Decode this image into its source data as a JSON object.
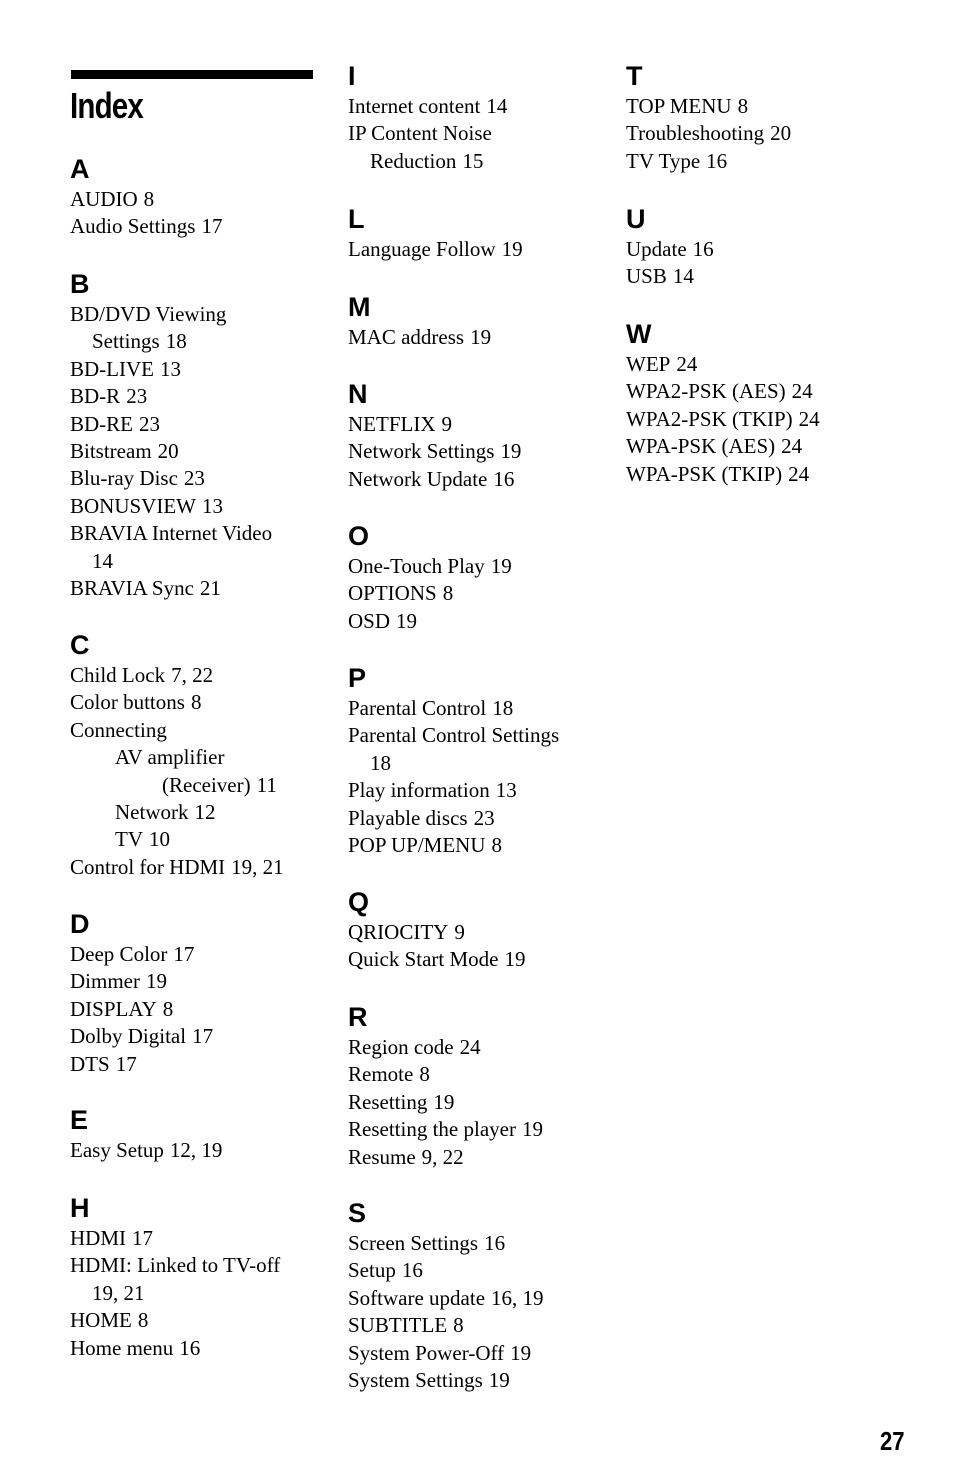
{
  "page": {
    "title": "Index",
    "page_number": "27"
  },
  "columns": [
    {
      "sections": [
        {
          "letter": "A",
          "lines": [
            {
              "text": "AUDIO",
              "pages": "8",
              "style": "entry"
            },
            {
              "text": "Audio Settings",
              "pages": "17",
              "style": "entry"
            }
          ]
        },
        {
          "letter": "B",
          "lines": [
            {
              "text": "BD/DVD Viewing",
              "pages": "",
              "style": "entry"
            },
            {
              "text": "Settings",
              "pages": "18",
              "style": "wrap"
            },
            {
              "text": "BD-LIVE",
              "pages": "13",
              "style": "entry"
            },
            {
              "text": "BD-R",
              "pages": "23",
              "style": "entry"
            },
            {
              "text": "BD-RE",
              "pages": "23",
              "style": "entry"
            },
            {
              "text": "Bitstream",
              "pages": "20",
              "style": "entry"
            },
            {
              "text": "Blu-ray Disc",
              "pages": "23",
              "style": "entry"
            },
            {
              "text": "BONUSVIEW",
              "pages": "13",
              "style": "entry"
            },
            {
              "text": "BRAVIA Internet Video",
              "pages": "",
              "style": "entry"
            },
            {
              "text": "",
              "pages": "14",
              "style": "wrap"
            },
            {
              "text": "BRAVIA Sync",
              "pages": "21",
              "style": "entry"
            }
          ]
        },
        {
          "letter": "C",
          "lines": [
            {
              "text": "Child Lock",
              "pages": "7, 22",
              "style": "entry"
            },
            {
              "text": "Color buttons",
              "pages": "8",
              "style": "entry"
            },
            {
              "text": "Connecting",
              "pages": "",
              "style": "entry"
            },
            {
              "text": "AV amplifier",
              "pages": "",
              "style": "sub1"
            },
            {
              "text": "(Receiver)",
              "pages": "11",
              "style": "sub2"
            },
            {
              "text": "Network",
              "pages": "12",
              "style": "sub1"
            },
            {
              "text": "TV",
              "pages": "10",
              "style": "sub1"
            },
            {
              "text": "Control for HDMI",
              "pages": "19, 21",
              "style": "entry"
            }
          ]
        },
        {
          "letter": "D",
          "lines": [
            {
              "text": "Deep Color",
              "pages": "17",
              "style": "entry"
            },
            {
              "text": "Dimmer",
              "pages": "19",
              "style": "entry"
            },
            {
              "text": "DISPLAY",
              "pages": "8",
              "style": "entry"
            },
            {
              "text": "Dolby Digital",
              "pages": "17",
              "style": "entry"
            },
            {
              "text": "DTS",
              "pages": "17",
              "style": "entry"
            }
          ]
        },
        {
          "letter": "E",
          "lines": [
            {
              "text": "Easy Setup",
              "pages": "12, 19",
              "style": "entry"
            }
          ]
        },
        {
          "letter": "H",
          "lines": [
            {
              "text": "HDMI",
              "pages": "17",
              "style": "entry"
            },
            {
              "text": "HDMI: Linked to TV-off",
              "pages": "",
              "style": "entry"
            },
            {
              "text": "",
              "pages": "19, 21",
              "style": "wrap"
            },
            {
              "text": "HOME",
              "pages": "8",
              "style": "entry"
            },
            {
              "text": "Home menu",
              "pages": "16",
              "style": "entry"
            }
          ]
        }
      ]
    },
    {
      "sections": [
        {
          "letter": "I",
          "lines": [
            {
              "text": "Internet content",
              "pages": "14",
              "style": "entry"
            },
            {
              "text": "IP Content Noise",
              "pages": "",
              "style": "entry"
            },
            {
              "text": "Reduction",
              "pages": "15",
              "style": "wrap"
            }
          ]
        },
        {
          "letter": "L",
          "lines": [
            {
              "text": "Language Follow",
              "pages": "19",
              "style": "entry"
            }
          ]
        },
        {
          "letter": "M",
          "lines": [
            {
              "text": "MAC address",
              "pages": "19",
              "style": "entry"
            }
          ]
        },
        {
          "letter": "N",
          "lines": [
            {
              "text": "NETFLIX",
              "pages": "9",
              "style": "entry"
            },
            {
              "text": "Network Settings",
              "pages": "19",
              "style": "entry"
            },
            {
              "text": "Network Update",
              "pages": "16",
              "style": "entry"
            }
          ]
        },
        {
          "letter": "O",
          "lines": [
            {
              "text": "One-Touch Play",
              "pages": "19",
              "style": "entry"
            },
            {
              "text": "OPTIONS",
              "pages": "8",
              "style": "entry"
            },
            {
              "text": "OSD",
              "pages": "19",
              "style": "entry"
            }
          ]
        },
        {
          "letter": "P",
          "lines": [
            {
              "text": "Parental Control",
              "pages": "18",
              "style": "entry"
            },
            {
              "text": "Parental Control Settings",
              "pages": "",
              "style": "entry"
            },
            {
              "text": "",
              "pages": "18",
              "style": "wrap"
            },
            {
              "text": "Play information",
              "pages": "13",
              "style": "entry"
            },
            {
              "text": "Playable discs",
              "pages": "23",
              "style": "entry"
            },
            {
              "text": "POP UP/MENU",
              "pages": "8",
              "style": "entry"
            }
          ]
        },
        {
          "letter": "Q",
          "lines": [
            {
              "text": "QRIOCITY",
              "pages": "9",
              "style": "entry"
            },
            {
              "text": "Quick Start Mode",
              "pages": "19",
              "style": "entry"
            }
          ]
        },
        {
          "letter": "R",
          "lines": [
            {
              "text": "Region code",
              "pages": "24",
              "style": "entry"
            },
            {
              "text": "Remote",
              "pages": "8",
              "style": "entry"
            },
            {
              "text": "Resetting",
              "pages": "19",
              "style": "entry"
            },
            {
              "text": "Resetting the player",
              "pages": "19",
              "style": "entry"
            },
            {
              "text": "Resume",
              "pages": "9, 22",
              "style": "entry"
            }
          ]
        },
        {
          "letter": "S",
          "lines": [
            {
              "text": "Screen Settings",
              "pages": "16",
              "style": "entry"
            },
            {
              "text": "Setup",
              "pages": "16",
              "style": "entry"
            },
            {
              "text": "Software update",
              "pages": "16, 19",
              "style": "entry"
            },
            {
              "text": "SUBTITLE",
              "pages": "8",
              "style": "entry"
            },
            {
              "text": "System Power-Off",
              "pages": "19",
              "style": "entry"
            },
            {
              "text": "System Settings",
              "pages": "19",
              "style": "entry"
            }
          ]
        }
      ]
    },
    {
      "sections": [
        {
          "letter": "T",
          "lines": [
            {
              "text": "TOP MENU",
              "pages": "8",
              "style": "entry"
            },
            {
              "text": "Troubleshooting",
              "pages": "20",
              "style": "entry"
            },
            {
              "text": "TV Type",
              "pages": "16",
              "style": "entry"
            }
          ]
        },
        {
          "letter": "U",
          "lines": [
            {
              "text": "Update",
              "pages": "16",
              "style": "entry"
            },
            {
              "text": "USB",
              "pages": "14",
              "style": "entry"
            }
          ]
        },
        {
          "letter": "W",
          "lines": [
            {
              "text": "WEP",
              "pages": "24",
              "style": "entry"
            },
            {
              "text": "WPA2-PSK (AES)",
              "pages": "24",
              "style": "entry"
            },
            {
              "text": "WPA2-PSK (TKIP)",
              "pages": "24",
              "style": "entry"
            },
            {
              "text": "WPA-PSK (AES)",
              "pages": "24",
              "style": "entry"
            },
            {
              "text": "WPA-PSK (TKIP)",
              "pages": "24",
              "style": "entry"
            }
          ]
        }
      ]
    }
  ]
}
